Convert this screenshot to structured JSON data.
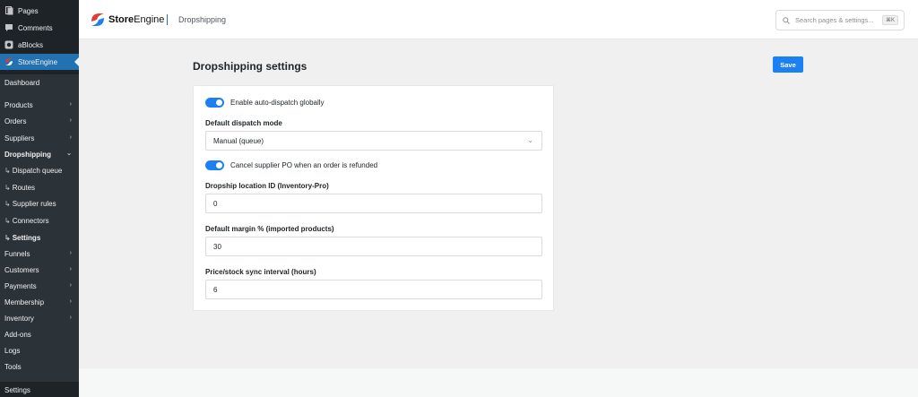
{
  "sidebar": {
    "top_items": [
      {
        "label": "Pages",
        "icon": "pages-icon"
      },
      {
        "label": "Comments",
        "icon": "comments-icon"
      },
      {
        "label": "aBlocks",
        "icon": "ablocks-icon"
      },
      {
        "label": "StoreEngine",
        "icon": "storeengine-icon"
      }
    ],
    "dashboard": "Dashboard",
    "menu": [
      {
        "label": "Products",
        "chevron": "›"
      },
      {
        "label": "Orders",
        "chevron": "›"
      },
      {
        "label": "Suppliers",
        "chevron": "›"
      },
      {
        "label": "Dropshipping",
        "chevron": "⌄"
      },
      {
        "label": "Dispatch queue",
        "prefix": "↳"
      },
      {
        "label": "Routes",
        "prefix": "↳"
      },
      {
        "label": "Supplier rules",
        "prefix": "↳"
      },
      {
        "label": "Connectors",
        "prefix": "↳"
      },
      {
        "label": "Settings",
        "prefix": "↳"
      },
      {
        "label": "Funnels",
        "chevron": "›"
      },
      {
        "label": "Customers",
        "chevron": "›"
      },
      {
        "label": "Payments",
        "chevron": "›"
      },
      {
        "label": "Membership",
        "chevron": "›"
      },
      {
        "label": "Inventory",
        "chevron": "›"
      },
      {
        "label": "Add-ons"
      },
      {
        "label": "Logs"
      },
      {
        "label": "Tools"
      }
    ],
    "bottom": "Settings"
  },
  "topbar": {
    "brand_bold": "Store",
    "brand_rest": "Engine",
    "breadcrumb": "Dropshipping",
    "search_placeholder": "Search pages & settings...",
    "search_shortcut": "⌘K"
  },
  "page": {
    "title": "Dropshipping settings",
    "save_label": "Save"
  },
  "settings": {
    "auto_dispatch_label": "Enable auto-dispatch globally",
    "dispatch_mode_label": "Default dispatch mode",
    "dispatch_mode_value": "Manual (queue)",
    "cancel_po_label": "Cancel supplier PO when an order is refunded",
    "location_label": "Dropship location ID (Inventory-Pro)",
    "location_value": "0",
    "margin_label": "Default margin % (imported products)",
    "margin_value": "30",
    "sync_label": "Price/stock sync interval (hours)",
    "sync_value": "6"
  },
  "colors": {
    "accent": "#1d80f2",
    "sidebar_bg": "#1d2327",
    "active_bg": "#2271b1"
  }
}
